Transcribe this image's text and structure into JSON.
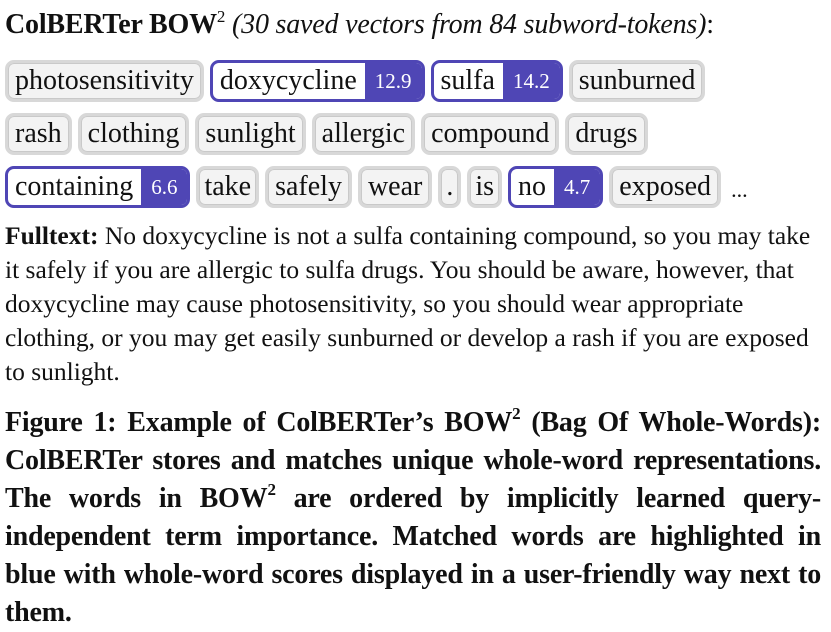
{
  "heading": {
    "bold_text": "ColBERTer BOW",
    "superscript": "2",
    "italic_text": "(30 saved vectors from 84 subword-tokens)",
    "colon": ":"
  },
  "tokens": {
    "row1": [
      {
        "word": "photosensitivity",
        "score": null
      },
      {
        "word": "doxycycline",
        "score": "12.9"
      },
      {
        "word": "sulfa",
        "score": "14.2"
      },
      {
        "word": "sunburned",
        "score": null
      }
    ],
    "row2": [
      {
        "word": "rash",
        "score": null
      },
      {
        "word": "clothing",
        "score": null
      },
      {
        "word": "sunlight",
        "score": null
      },
      {
        "word": "allergic",
        "score": null
      },
      {
        "word": "compound",
        "score": null
      },
      {
        "word": "drugs",
        "score": null
      }
    ],
    "row3": [
      {
        "word": "containing",
        "score": "6.6"
      },
      {
        "word": "take",
        "score": null
      },
      {
        "word": "safely",
        "score": null
      },
      {
        "word": "wear",
        "score": null
      },
      {
        "word": ".",
        "score": null
      },
      {
        "word": "is",
        "score": null
      },
      {
        "word": "no",
        "score": "4.7"
      },
      {
        "word": "exposed",
        "score": null
      }
    ],
    "ellipsis": "..."
  },
  "fulltext": {
    "label": "Fulltext:",
    "text": "No doxycycline is not a sulfa containing compound, so you may take it safely if you are allergic to sulfa drugs. You should be aware, however, that doxycycline may cause photosensitivity, so you should wear appropriate clothing, or you may get easily sunburned or develop a rash if you are exposed to sunlight."
  },
  "caption": {
    "part1": "Figure 1: Example of ColBERTer’s BOW",
    "sup1": "2",
    "part2": " (Bag Of Whole-Words): ColBERTer stores and matches unique whole-word representations. The words in BOW",
    "sup2": "2",
    "part3": " are ordered by implicitly learned query-independent term importance. Matched words are highlighted in blue with whole-word scores displayed in a user-friendly way next to them."
  },
  "colors": {
    "match_accent": "#4f46b5",
    "token_border": "#d8d8d8",
    "token_fill": "#f3f3f3"
  }
}
